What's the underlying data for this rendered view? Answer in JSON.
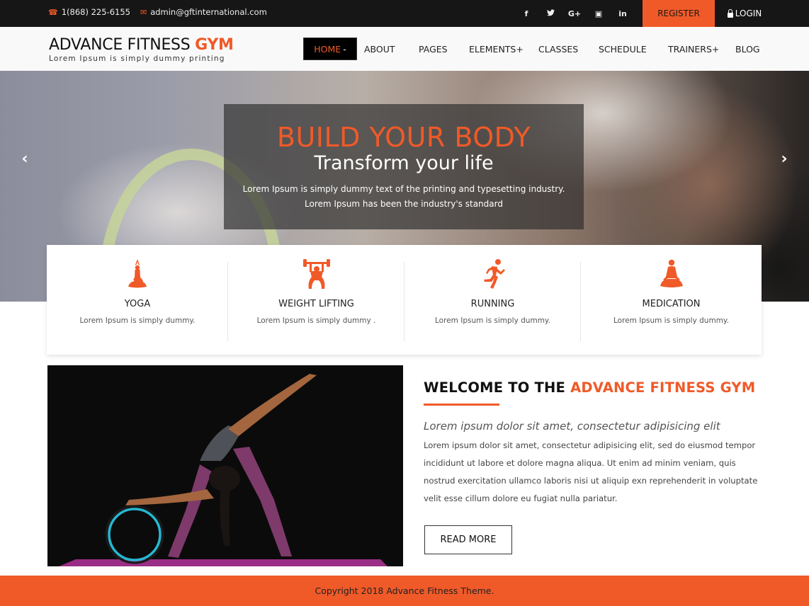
{
  "topbar": {
    "phone": "1(868) 225-6155",
    "email": "admin@gftinternational.com",
    "social": [
      {
        "name": "facebook",
        "glyph": "f"
      },
      {
        "name": "twitter",
        "glyph": "✉"
      },
      {
        "name": "google-plus",
        "glyph": "G+"
      },
      {
        "name": "instagram",
        "glyph": "▣"
      },
      {
        "name": "linkedin",
        "glyph": "in"
      }
    ],
    "register_label": "REGISTER",
    "login_label": "LOGIN"
  },
  "header": {
    "logo_main": "ADVANCE FITNESS ",
    "logo_accent": "GYM",
    "tagline": "Lorem Ipsum is simply dummy printing"
  },
  "nav": {
    "items": [
      {
        "label": "HOME",
        "suffix": "-",
        "active": true
      },
      {
        "label": "ABOUT"
      },
      {
        "label": "PAGES"
      },
      {
        "label": "ELEMENTS",
        "suffix": "+"
      },
      {
        "label": "CLASSES"
      },
      {
        "label": "SCHEDULE"
      },
      {
        "label": "TRAINERS",
        "suffix": "+"
      },
      {
        "label": "BLOG"
      }
    ]
  },
  "hero": {
    "title": "BUILD YOUR BODY",
    "subtitle": "Transform your life",
    "line1": "Lorem Ipsum is simply dummy text of the printing and typesetting industry.",
    "line2": "Lorem Ipsum has been the industry's standard",
    "prev_glyph": "‹",
    "next_glyph": "›"
  },
  "features": [
    {
      "icon": "yoga-icon",
      "title": "YOGA",
      "desc": "Lorem Ipsum is simply dummy."
    },
    {
      "icon": "weight-lifting-icon",
      "title": "WEIGHT LIFTING",
      "desc": "Lorem Ipsum is simply dummy ."
    },
    {
      "icon": "running-icon",
      "title": "RUNNING",
      "desc": "Lorem Ipsum is simply dummy."
    },
    {
      "icon": "meditation-icon",
      "title": "MEDICATION",
      "desc": "Lorem Ipsum is simply dummy."
    }
  ],
  "welcome": {
    "heading_prefix": "WELCOME TO THE ",
    "heading_accent": "ADVANCE FITNESS GYM",
    "lead": "Lorem ipsum dolor sit amet, consectetur adipisicing elit",
    "body": "Lorem ipsum dolor sit amet, consectetur adipisicing elit, sed do eiusmod tempor incididunt ut labore et dolore magna aliqua. Ut enim ad minim veniam, quis nostrud exercitation ullamco laboris nisi ut aliquip exn reprehenderit in voluptate velit esse cillum dolore eu fugiat nulla pariatur.",
    "button_label": "READ MORE"
  },
  "footer": {
    "copyright": "Copyright 2018 Advance Fitness Theme."
  },
  "colors": {
    "accent": "#f05a28",
    "topbar": "#161616",
    "header_bg": "#f9f9f9"
  }
}
